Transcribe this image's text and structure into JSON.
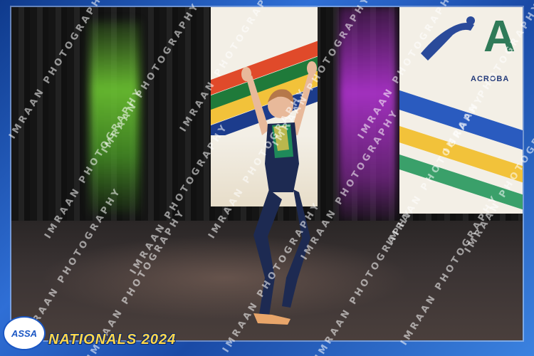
{
  "photo": {
    "description_tag": "gymnast-on-stage"
  },
  "banner_right": {
    "big_letter": "A",
    "label": "ACROBA"
  },
  "watermark": {
    "text": "IMRAAN PHOTOGRAPHY",
    "color": "#ffffff"
  },
  "footer": {
    "logo_text": "ASSA",
    "event_title": "NATIONALS 2024",
    "title_color": "#ffd84a",
    "frame_color": "#1d4fa8"
  }
}
